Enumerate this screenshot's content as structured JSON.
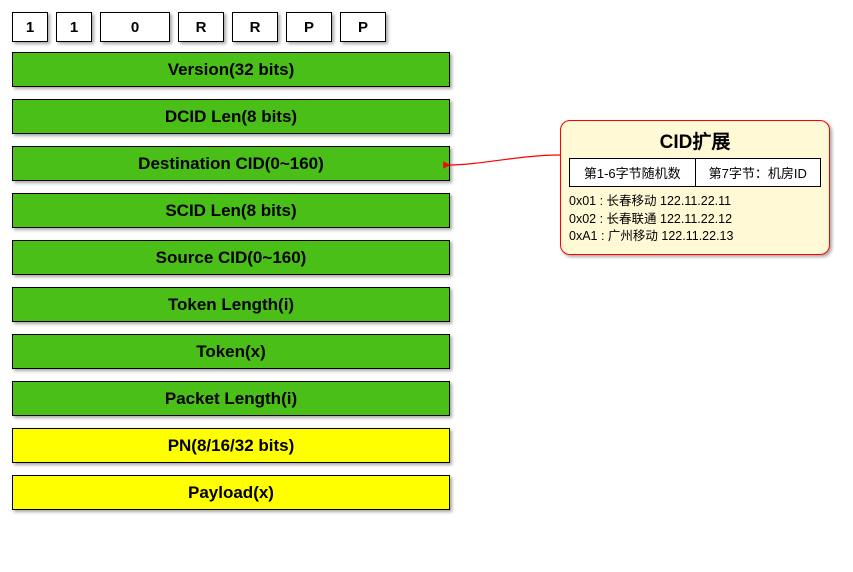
{
  "bits": [
    "1",
    "1",
    "0",
    "R",
    "R",
    "P",
    "P"
  ],
  "fields": [
    {
      "label": "Version(32 bits)",
      "color": "green"
    },
    {
      "label": "DCID Len(8 bits)",
      "color": "green"
    },
    {
      "label": "Destination CID(0~160)",
      "color": "green"
    },
    {
      "label": "SCID Len(8 bits)",
      "color": "green"
    },
    {
      "label": "Source CID(0~160)",
      "color": "green"
    },
    {
      "label": "Token Length(i)",
      "color": "green"
    },
    {
      "label": "Token(x)",
      "color": "green"
    },
    {
      "label": "Packet Length(i)",
      "color": "green"
    },
    {
      "label": "PN(8/16/32 bits)",
      "color": "yellow"
    },
    {
      "label": "Payload(x)",
      "color": "yellow"
    }
  ],
  "callout": {
    "title": "CID扩展",
    "cols": [
      "第1-6字节随机数",
      "第7字节：机房ID"
    ],
    "rows": [
      "0x01 : 长春移动 122.11.22.11",
      "0x02 : 长春联通 122.11.22.12",
      "0xA1 : 广州移动 122.11.22.13"
    ]
  }
}
